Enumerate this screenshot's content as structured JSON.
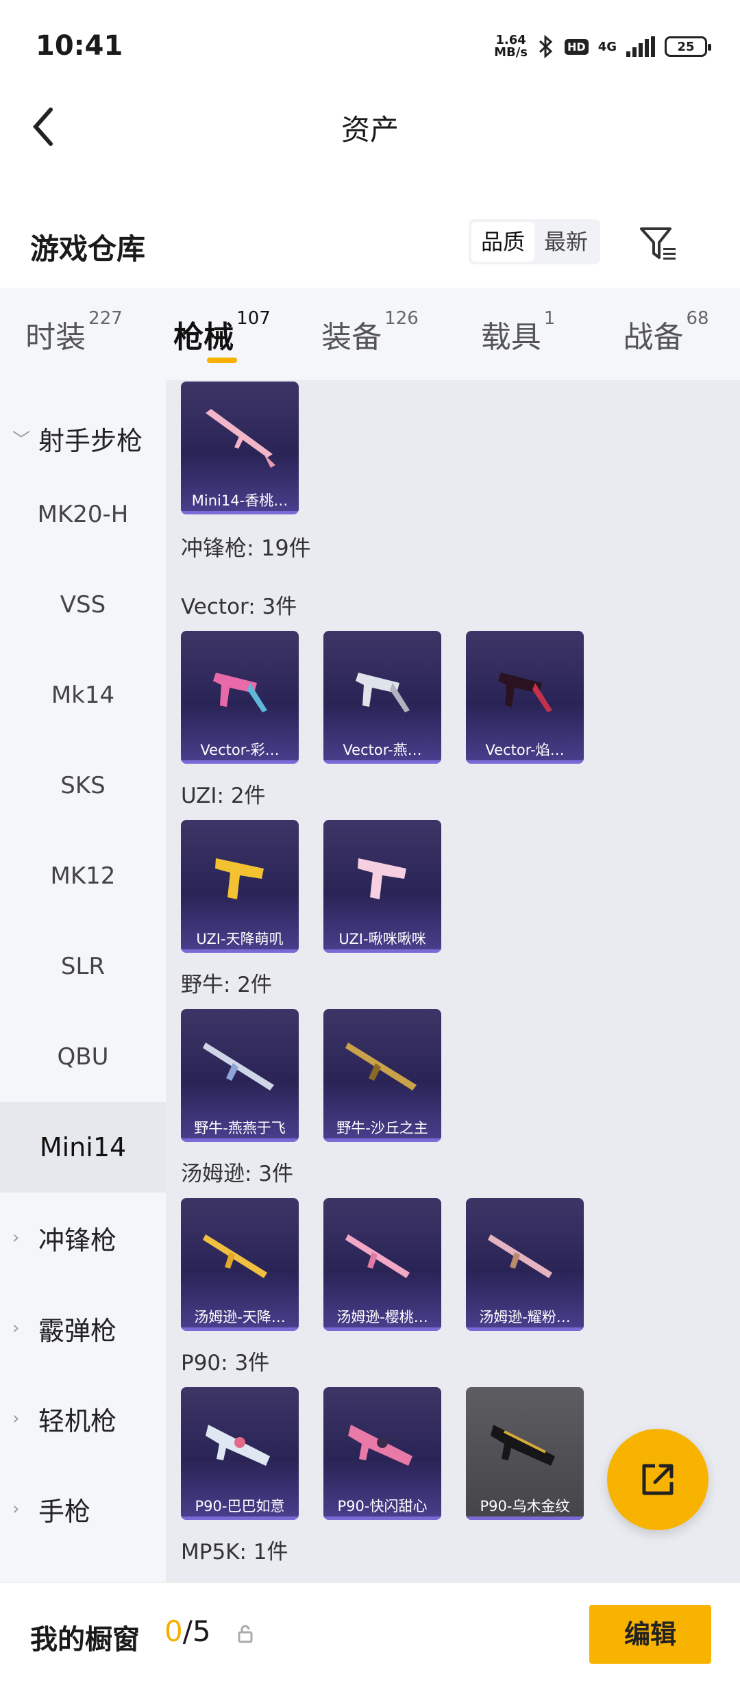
{
  "status_bar": {
    "time": "10:41",
    "net_speed_top": "1.64",
    "net_speed_unit": "MB/s",
    "hd": "HD",
    "net": "4G",
    "battery": "25"
  },
  "header": {
    "title": "资产"
  },
  "warehouse": {
    "title": "游戏仓库",
    "sort_quality": "品质",
    "sort_latest": "最新"
  },
  "tabs": [
    {
      "label": "时装",
      "count": "227"
    },
    {
      "label": "枪械",
      "count": "107"
    },
    {
      "label": "装备",
      "count": "126"
    },
    {
      "label": "载具",
      "count": "1"
    },
    {
      "label": "战备",
      "count": "68"
    }
  ],
  "sidebar": {
    "group_open": "射手步枪",
    "items": [
      "MK20-H",
      "VSS",
      "Mk14",
      "SKS",
      "MK12",
      "SLR",
      "QBU",
      "Mini14"
    ],
    "groups": [
      "冲锋枪",
      "霰弹枪",
      "轻机枪",
      "手枪"
    ]
  },
  "content": {
    "top_card": "Mini14-香桃…",
    "smg_header": "冲锋枪: 19件",
    "sections": [
      {
        "title": "Vector: 3件",
        "items": [
          "Vector-彩…",
          "Vector-燕…",
          "Vector-焰…"
        ]
      },
      {
        "title": "UZI: 2件",
        "items": [
          "UZI-天降萌叽",
          "UZI-啾咪啾咪"
        ]
      },
      {
        "title": "野牛: 2件",
        "items": [
          "野牛-燕燕于飞",
          "野牛-沙丘之主"
        ]
      },
      {
        "title": "汤姆逊: 3件",
        "items": [
          "汤姆逊-天降…",
          "汤姆逊-樱桃…",
          "汤姆逊-耀粉…"
        ]
      },
      {
        "title": "P90: 3件",
        "items": [
          "P90-巴巴如意",
          "P90-快闪甜心",
          "P90-乌木金纹"
        ]
      }
    ],
    "next_title": "MP5K: 1件"
  },
  "bottom_bar": {
    "title": "我的橱窗",
    "count_current": "0",
    "count_total": "/5",
    "edit_label": "编辑"
  },
  "colors": {
    "accent": "#f8b300",
    "card_bg": "#2a2456"
  }
}
